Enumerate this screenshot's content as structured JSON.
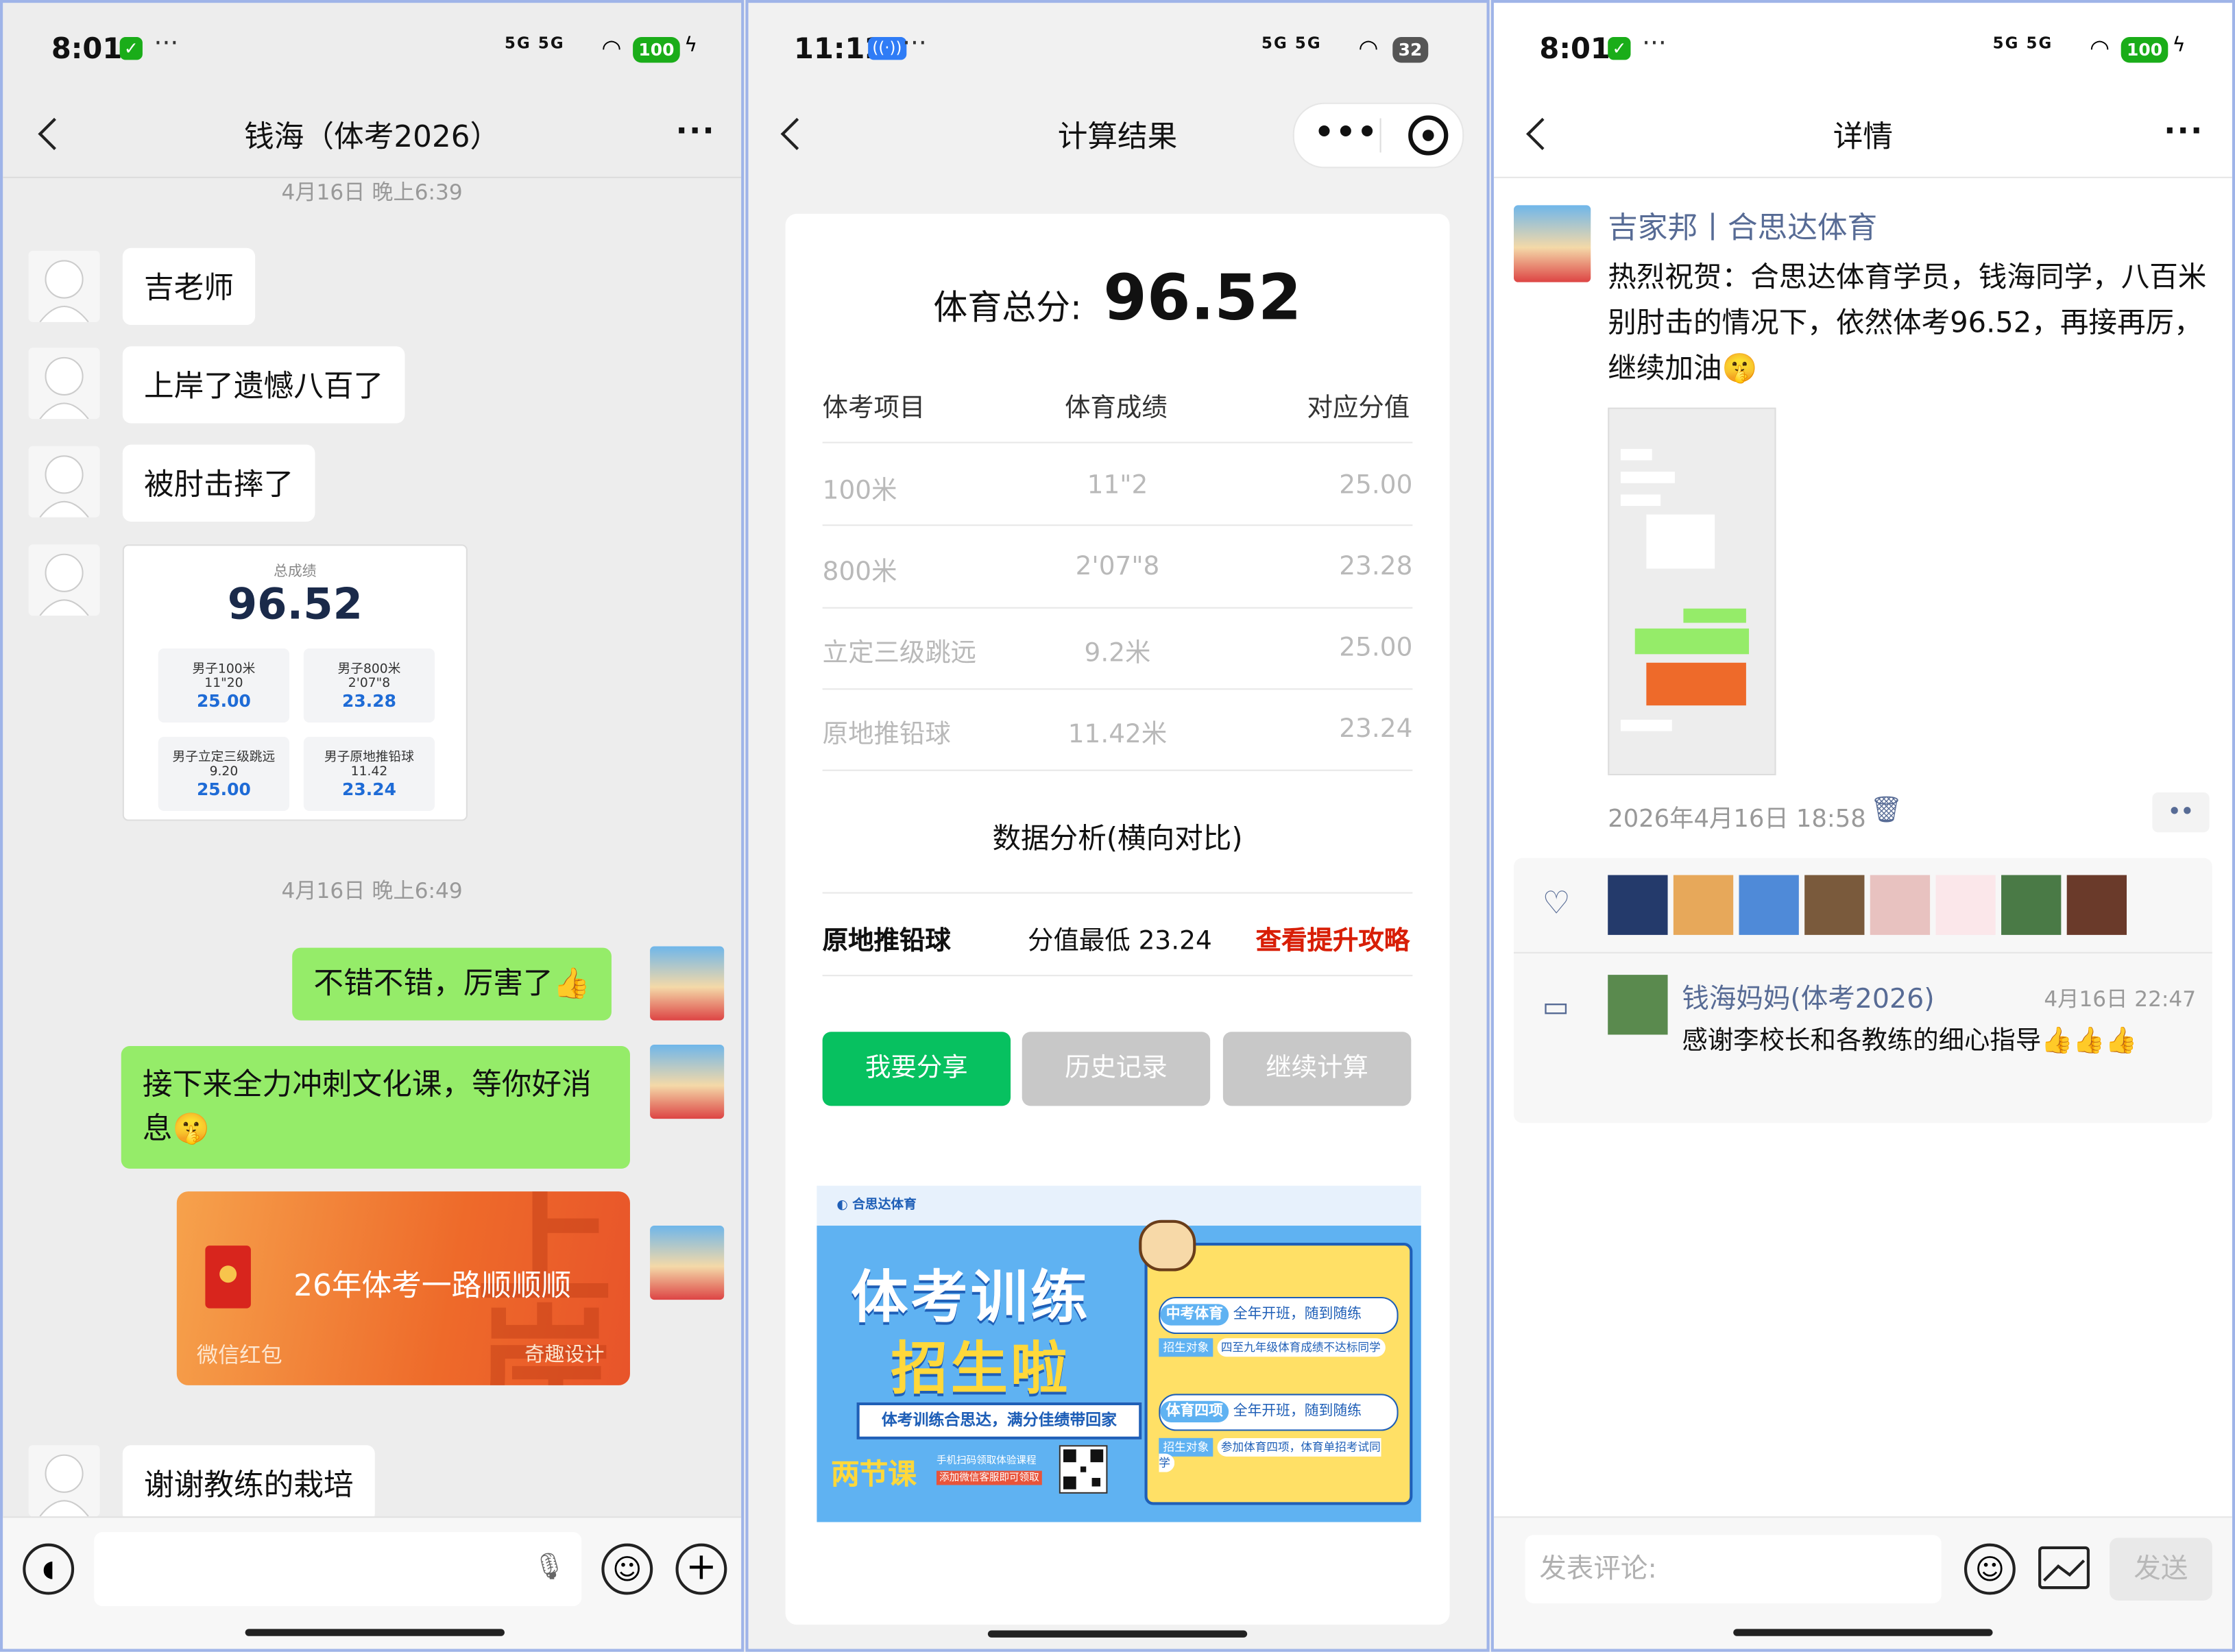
{
  "colors": {
    "wechat_green": "#95ec69",
    "primary_green": "#07c160",
    "link_blue": "#576b95",
    "red": "#d81e06",
    "gray_btn": "#c8c8c8",
    "redpacket": "#f08a35"
  },
  "chat": {
    "status": {
      "time": "8:01",
      "signal": "5G 5G",
      "battery": "100"
    },
    "title": "钱海（体考2026）",
    "ts1": "4月16日 晚上6:39",
    "msg1": "吉老师",
    "msg2": "上岸了遗憾八百了",
    "msg3": "被肘击摔了",
    "score_card": {
      "label": "总成绩",
      "total": "96.52",
      "cells": [
        {
          "name": "男子100米",
          "perf": "11\"20",
          "score": "25.00"
        },
        {
          "name": "男子800米",
          "perf": "2'07\"8",
          "score": "23.28"
        },
        {
          "name": "男子立定三级跳远",
          "perf": "9.20",
          "score": "25.00"
        },
        {
          "name": "男子原地推铅球",
          "perf": "11.42",
          "score": "23.24"
        }
      ]
    },
    "ts2": "4月16日 晚上6:49",
    "msg4": "不错不错，厉害了",
    "msg5": "接下来全力冲刺文化课，等你好消息",
    "redpacket": {
      "text": "26年体考一路顺顺顺",
      "label": "微信红包",
      "brand": "奇趣设计",
      "art": "上岸"
    },
    "msg6": "谢谢教练的栽培"
  },
  "calc": {
    "status": {
      "time": "11:12",
      "signal": "5G 5G",
      "battery": "32"
    },
    "title": "计算结果",
    "total_label": "体育总分:",
    "total_value": "96.52",
    "headers": [
      "体考项目",
      "体育成绩",
      "对应分值"
    ],
    "rows": [
      {
        "item": "100米",
        "perf": "11\"2",
        "score": "25.00"
      },
      {
        "item": "800米",
        "perf": "2'07\"8",
        "score": "23.28"
      },
      {
        "item": "立定三级跳远",
        "perf": "9.2米",
        "score": "25.00"
      },
      {
        "item": "原地推铅球",
        "perf": "11.42米",
        "score": "23.24"
      }
    ],
    "analysis_title": "数据分析(横向对比)",
    "analysis": {
      "item": "原地推铅球",
      "text": "分值最低 23.24",
      "link": "查看提升攻略"
    },
    "buttons": {
      "share": "我要分享",
      "history": "历史记录",
      "continue": "继续计算"
    },
    "banner": {
      "title1": "体考训练",
      "title2": "招生啦",
      "slogan": "体考训练合思达，满分佳绩带回家",
      "tag": "两节课",
      "small1": "手机扫码领取体验课程",
      "small2": "添加微信客服即可领取",
      "c1_tag": "中考体育",
      "c1_text": "全年开班，随到随练",
      "c1_obj": "招生对象",
      "c1_desc": "四至九年级体育成绩不达标同学",
      "c2_tag": "体育四项",
      "c2_text": "全年开班，随到随练",
      "c2_obj": "招生对象",
      "c2_desc": "参加体育四项，体育单招考试同学"
    }
  },
  "moment": {
    "status": {
      "time": "8:01",
      "signal": "5G 5G",
      "battery": "100"
    },
    "title": "详情",
    "author": "吉家邦丨合思达体育",
    "text": "热烈祝贺：合思达体育学员，钱海同学，八百米别肘击的情况下，依然体考96.52，再接再厉，继续加油",
    "time": "2026年4月16日 18:58",
    "comment": {
      "name": "钱海妈妈(体考2026)",
      "time": "4月16日 22:47",
      "text": "感谢李校长和各教练的细心指导"
    },
    "input_placeholder": "发表评论:",
    "send": "发送"
  }
}
